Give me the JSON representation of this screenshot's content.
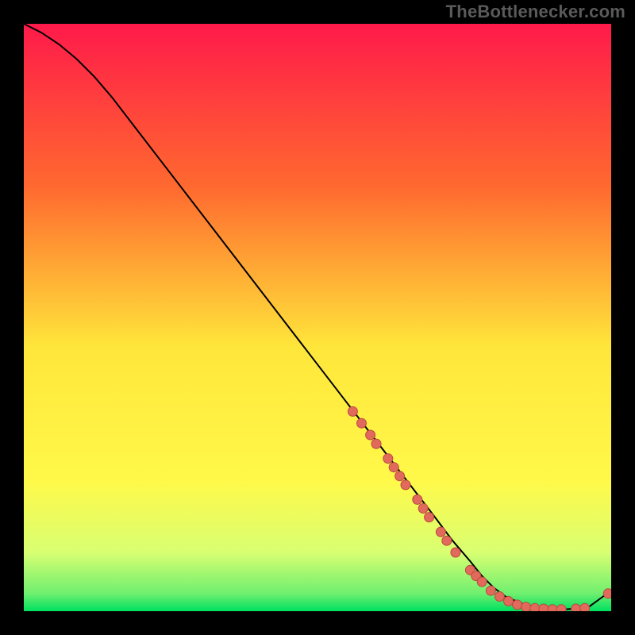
{
  "watermark": "TheBottlenecker.com",
  "chart_data": {
    "type": "line",
    "title": "",
    "xlabel": "",
    "ylabel": "",
    "xlim": [
      0,
      100
    ],
    "ylim": [
      0,
      100
    ],
    "grid": false,
    "legend": false,
    "background_gradient": {
      "top": "#ff1a4a",
      "upper_mid": "#ff8a2a",
      "mid": "#ffe63a",
      "lower_mid": "#f7ff6a",
      "near_bottom": "#c8ff7a",
      "bottom": "#00e060"
    },
    "series": [
      {
        "name": "curve",
        "color": "#000000",
        "x": [
          0,
          3,
          6,
          9,
          12,
          15,
          20,
          25,
          30,
          35,
          40,
          45,
          50,
          55,
          60,
          65,
          70,
          73,
          76,
          78,
          80,
          82,
          85,
          88,
          92,
          96,
          100
        ],
        "y": [
          100,
          98.5,
          96.5,
          94,
          91,
          87.5,
          81,
          74.5,
          68,
          61.5,
          55,
          48.5,
          42,
          35.5,
          29,
          22.5,
          16,
          12,
          8.5,
          6,
          4,
          2.5,
          1.2,
          0.6,
          0.3,
          0.6,
          3.5
        ]
      }
    ],
    "scatter": {
      "name": "markers",
      "color": "#e26a5c",
      "stroke": "#b94a3e",
      "radius": 6,
      "points": [
        {
          "x": 56,
          "y": 34
        },
        {
          "x": 57.5,
          "y": 32
        },
        {
          "x": 59,
          "y": 30
        },
        {
          "x": 60,
          "y": 28.5
        },
        {
          "x": 62,
          "y": 26
        },
        {
          "x": 63,
          "y": 24.5
        },
        {
          "x": 64,
          "y": 23
        },
        {
          "x": 65,
          "y": 21.5
        },
        {
          "x": 67,
          "y": 19
        },
        {
          "x": 68,
          "y": 17.5
        },
        {
          "x": 69,
          "y": 16
        },
        {
          "x": 71,
          "y": 13.5
        },
        {
          "x": 72,
          "y": 12
        },
        {
          "x": 73.5,
          "y": 10
        },
        {
          "x": 76,
          "y": 7
        },
        {
          "x": 77,
          "y": 6
        },
        {
          "x": 78,
          "y": 5
        },
        {
          "x": 79.5,
          "y": 3.5
        },
        {
          "x": 81,
          "y": 2.5
        },
        {
          "x": 82.5,
          "y": 1.7
        },
        {
          "x": 84,
          "y": 1.1
        },
        {
          "x": 85.5,
          "y": 0.7
        },
        {
          "x": 87,
          "y": 0.5
        },
        {
          "x": 88.5,
          "y": 0.4
        },
        {
          "x": 90,
          "y": 0.3
        },
        {
          "x": 91.5,
          "y": 0.3
        },
        {
          "x": 94,
          "y": 0.4
        },
        {
          "x": 95.5,
          "y": 0.5
        },
        {
          "x": 99.5,
          "y": 3.0
        }
      ]
    }
  }
}
